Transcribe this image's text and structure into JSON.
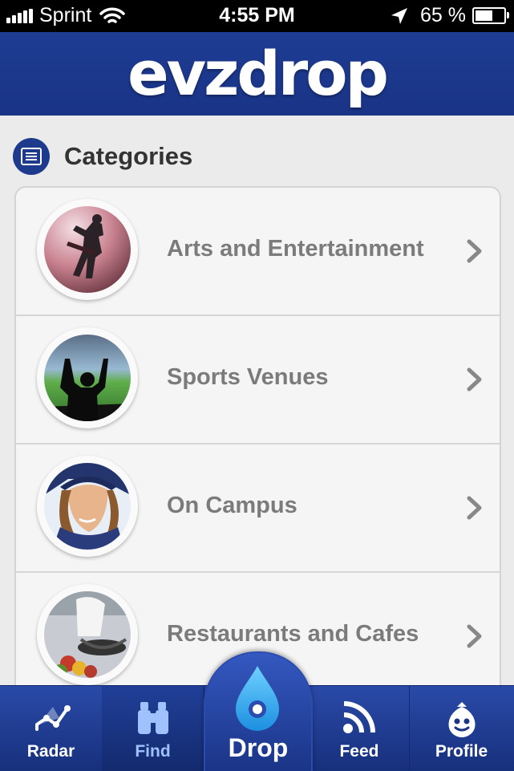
{
  "status_bar": {
    "carrier": "Sprint",
    "time": "4:55 PM",
    "battery": "65 %",
    "battery_level": 0.65
  },
  "header": {
    "logo": "evzdrop"
  },
  "section": {
    "title": "Categories",
    "icon": "list-icon"
  },
  "categories": [
    {
      "label": "Arts and Entertainment",
      "icon": "chevron-right-icon"
    },
    {
      "label": "Sports Venues",
      "icon": "chevron-right-icon"
    },
    {
      "label": "On Campus",
      "icon": "chevron-right-icon"
    },
    {
      "label": "Restaurants and Cafes",
      "icon": "chevron-right-icon"
    }
  ],
  "tabs": {
    "radar": {
      "label": "Radar",
      "icon": "radar-chart-icon"
    },
    "find": {
      "label": "Find",
      "icon": "binoculars-icon"
    },
    "drop": {
      "label": "Drop",
      "icon": "water-drop-icon"
    },
    "feed": {
      "label": "Feed",
      "icon": "rss-feed-icon"
    },
    "profile": {
      "label": "Profile",
      "icon": "profile-face-icon"
    }
  },
  "colors": {
    "brand_blue": "#1d3c93",
    "label_gray": "#7b7b7b",
    "active_tab_text": "#9fc2ff"
  }
}
